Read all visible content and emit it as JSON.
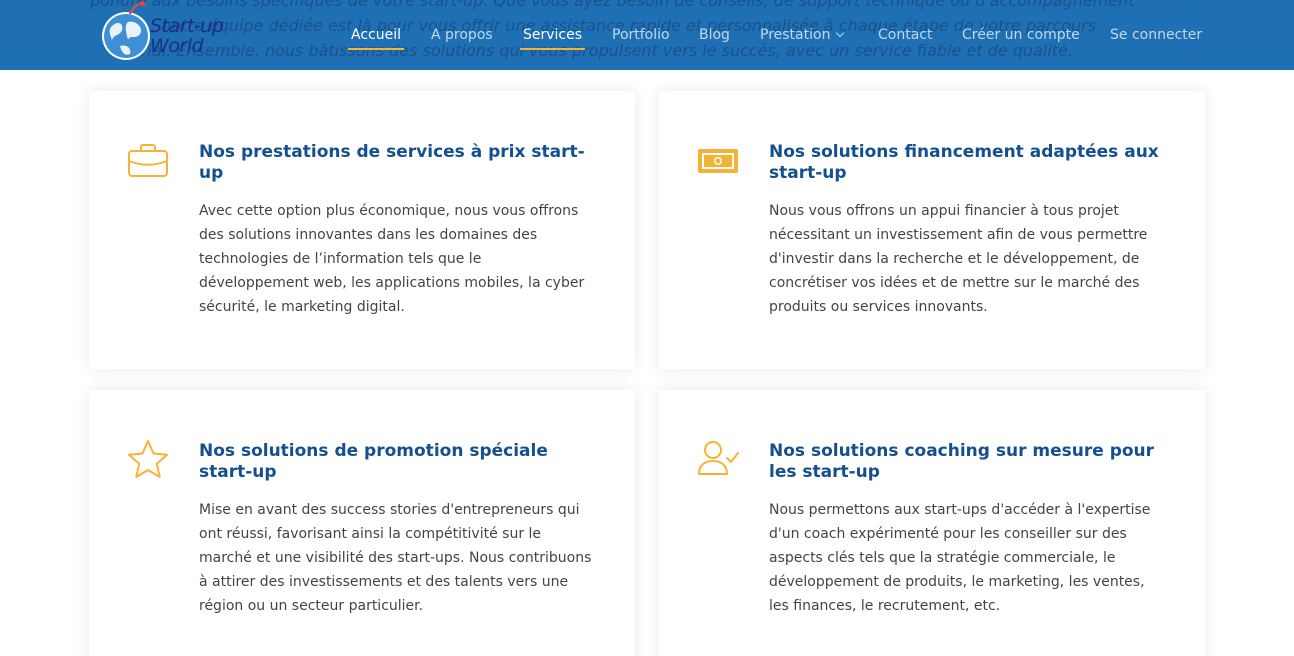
{
  "header": {
    "background_text": [
      "pondre aux besoins spécifiques de votre start-up. Que vous ayez besoin de conseils, de support technique ou d'accompagnement",
      "            , notre équipe dédiée est là pour vous offrir une assistance rapide et personnalisée à chaque étape de votre parcours",
      "          rial. Ensemble, nous bâtissons des solutions qui vous propulsent vers le succès, avec un service fiable et de qualité."
    ],
    "logo": {
      "line1": "Start-up",
      "line2": "World"
    },
    "nav": [
      {
        "label": "Accueil"
      },
      {
        "label": "A propos"
      },
      {
        "label": "Services"
      },
      {
        "label": "Portfolio"
      },
      {
        "label": "Blog"
      },
      {
        "label": "Prestation"
      },
      {
        "label": "Contact"
      },
      {
        "label": "Créer un compte"
      },
      {
        "label": "Se connecter"
      }
    ]
  },
  "services": [
    {
      "icon": "briefcase-icon",
      "title": "Nos prestations de services à prix start-up",
      "description": "Avec cette option plus économique, nous vous offrons des solutions innovantes dans les domaines des technologies de l’information tels que le développement web, les applications mobiles, la cyber sécurité, le marketing digital."
    },
    {
      "icon": "cash-icon",
      "title": "Nos solutions financement adaptées aux start-up",
      "description": "Nous vous offrons un appui financier à tous projet nécessitant un investissement afin de vous permettre d'investir dans la recherche et le développement, de concrétiser vos idées et de mettre sur le marché des produits ou services innovants."
    },
    {
      "icon": "star-icon",
      "title": "Nos solutions de promotion spéciale start-up",
      "description": "Mise en avant des success stories d'entrepreneurs qui ont réussi, favorisant ainsi la compétitivité sur le marché et une visibilité des start-ups. Nous contribuons à attirer des investissements et des talents vers une région ou un secteur particulier."
    },
    {
      "icon": "person-check-icon",
      "title": "Nos solutions coaching sur mesure pour les start-up",
      "description": "Nous permettons aux start-ups d'accéder à l'expertise d'un coach expérimenté pour les conseiller sur des aspects clés tels que la stratégie commerciale, le développement de produits, le marketing, les ventes, les finances, le recrutement, etc."
    }
  ],
  "colors": {
    "header_bg": "#1f6fb4",
    "accent": "#f5b335",
    "title": "#144f8f",
    "text": "#444444"
  }
}
